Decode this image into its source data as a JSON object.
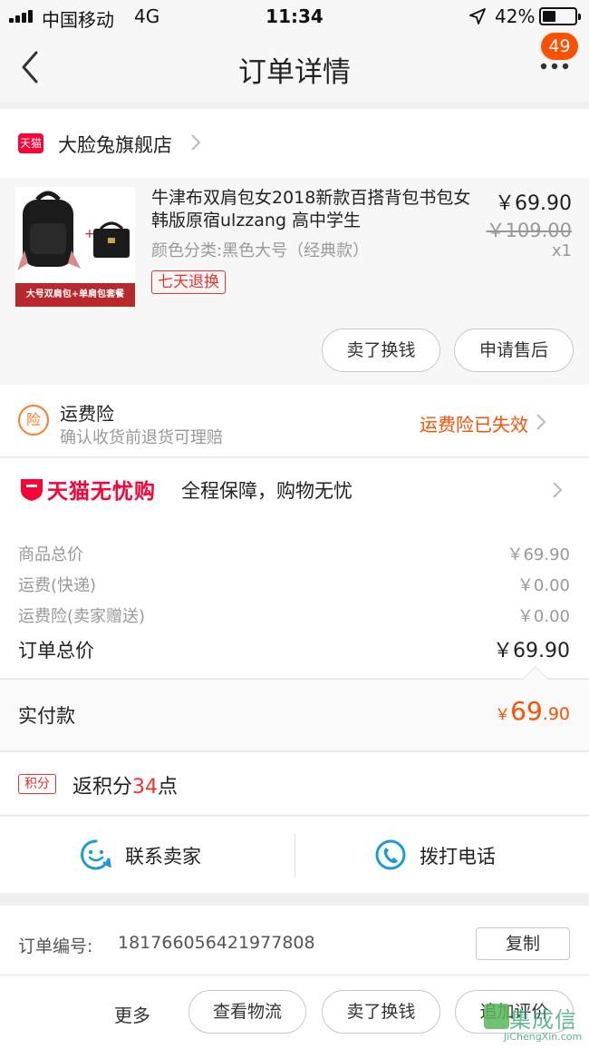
{
  "status_bar": {
    "carrier": "中国移动",
    "network": "4G",
    "time": "11:34",
    "battery_percent": "42%",
    "battery_level": 0.42
  },
  "nav": {
    "title": "订单详情",
    "badge_count": "49"
  },
  "store": {
    "brand_mark": "天猫",
    "name": "大脸兔旗舰店"
  },
  "product": {
    "title": "牛津布双肩包女2018新款百搭背包书包女韩版原宿ulzzang 高中学生",
    "sku": "颜色分类:黑色大号（经典款）",
    "tag": "七天退换",
    "price": "￥69.90",
    "original_price": "￥109.00",
    "quantity": "x1",
    "image_banner": "大号双肩包+单肩包套餐",
    "actions": [
      "卖了换钱",
      "申请售后"
    ]
  },
  "freight_insurance": {
    "icon_char": "险",
    "title": "运费险",
    "desc": "确认收货前退货可理赔",
    "status": "运费险已失效"
  },
  "worry_free": {
    "brand": "天猫无忧购",
    "text": "全程保障，购物无忧"
  },
  "summary": {
    "rows": [
      {
        "label": "商品总价",
        "value": "￥69.90"
      },
      {
        "label": "运费(快递)",
        "value": "￥0.00"
      },
      {
        "label": "运费险(卖家赠送)",
        "value": "￥0.00"
      }
    ],
    "total_label": "订单总价",
    "total_value": "￥69.90"
  },
  "paid": {
    "label": "实付款",
    "currency": "￥",
    "integer": "69",
    "decimal": ".90"
  },
  "points": {
    "tag": "积分",
    "prefix": "返积分",
    "value": "34",
    "suffix": "点"
  },
  "contact": {
    "seller": "联系卖家",
    "phone": "拨打电话"
  },
  "order_info": {
    "number_label": "订单编号:",
    "number_value": "181766056421977808",
    "copy_label": "复制"
  },
  "action_bar": {
    "more": "更多",
    "buttons": [
      "查看物流",
      "卖了换钱",
      "追加评价"
    ]
  },
  "watermark": {
    "title": "集成信",
    "site": "JiChengXin.com"
  },
  "colors": {
    "accent": "#ff5000",
    "tmall_red": "#ff0036",
    "contact_blue": "#1e9bd7",
    "watermark_green": "#2fa36b"
  }
}
